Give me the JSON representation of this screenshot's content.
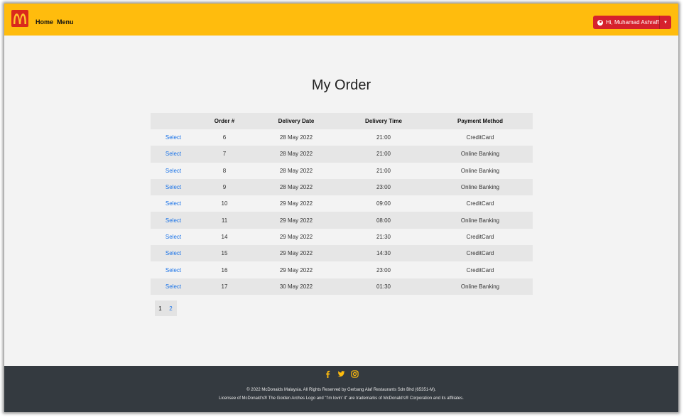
{
  "brand": {
    "logo_color": "#da291c",
    "bar_color": "#ffbc0d"
  },
  "nav": {
    "home": "Home",
    "menu": "Menu"
  },
  "user": {
    "label": "Hi, Muhamad Ashraff",
    "icon": "user-circle-icon"
  },
  "page": {
    "title": "My Order"
  },
  "table": {
    "headers": [
      "",
      "Order #",
      "Delivery Date",
      "Delivery Time",
      "Payment Method"
    ],
    "rows": [
      {
        "action": "Select",
        "order": "6",
        "date": "28 May 2022",
        "time": "21:00",
        "payment": "CreditCard"
      },
      {
        "action": "Select",
        "order": "7",
        "date": "28 May 2022",
        "time": "21:00",
        "payment": "Online Banking"
      },
      {
        "action": "Select",
        "order": "8",
        "date": "28 May 2022",
        "time": "21:00",
        "payment": "Online Banking"
      },
      {
        "action": "Select",
        "order": "9",
        "date": "28 May 2022",
        "time": "23:00",
        "payment": "Online Banking"
      },
      {
        "action": "Select",
        "order": "10",
        "date": "29 May 2022",
        "time": "09:00",
        "payment": "CreditCard"
      },
      {
        "action": "Select",
        "order": "11",
        "date": "29 May 2022",
        "time": "08:00",
        "payment": "Online Banking"
      },
      {
        "action": "Select",
        "order": "14",
        "date": "29 May 2022",
        "time": "21:30",
        "payment": "CreditCard"
      },
      {
        "action": "Select",
        "order": "15",
        "date": "29 May 2022",
        "time": "14:30",
        "payment": "CreditCard"
      },
      {
        "action": "Select",
        "order": "16",
        "date": "29 May 2022",
        "time": "23:00",
        "payment": "CreditCard"
      },
      {
        "action": "Select",
        "order": "17",
        "date": "30 May 2022",
        "time": "01:30",
        "payment": "Online Banking"
      }
    ]
  },
  "pagination": {
    "pages": [
      "1",
      "2"
    ],
    "current": "1"
  },
  "footer": {
    "social_icons": [
      "facebook-icon",
      "twitter-icon",
      "instagram-icon"
    ],
    "social_color": "#ffbc0d",
    "copyright": "© 2022 McDonalds Malaysia. All Rights Reserved by Gerbang Alaf Restaurants Sdn Bhd (65351-M).",
    "license": "Licensee of McDonald's® The Golden Arches Logo and \"I'm lovin' it\" are trademarks of McDonald's® Corporation and its affiliates."
  }
}
